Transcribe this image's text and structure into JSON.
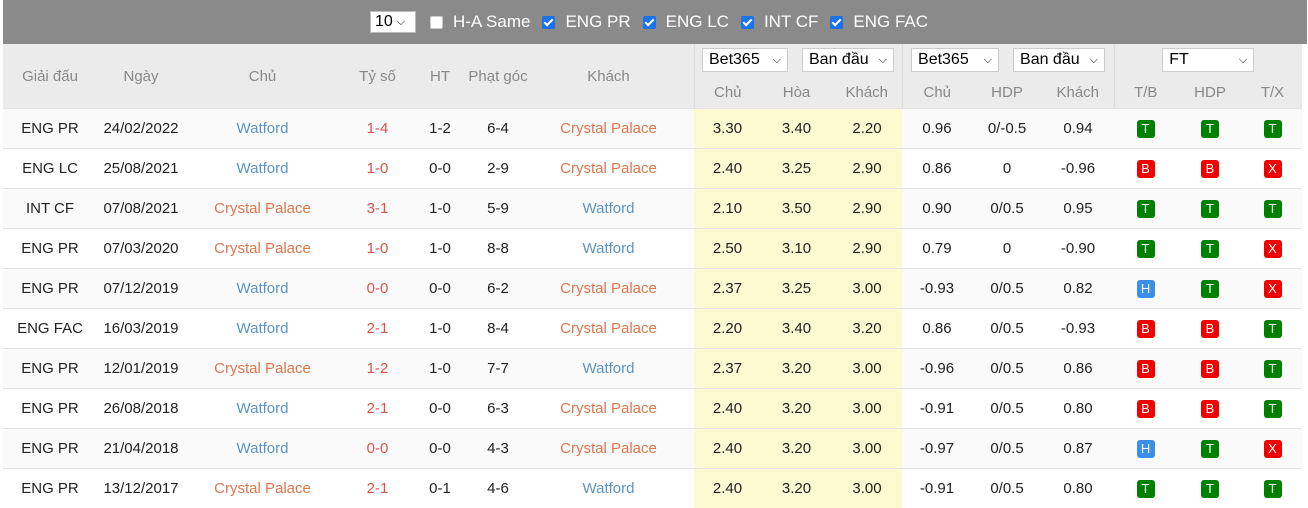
{
  "filter_bar": {
    "count_select": "10",
    "checkboxes": [
      {
        "label": "H-A Same",
        "checked": false
      },
      {
        "label": "ENG PR",
        "checked": true
      },
      {
        "label": "ENG LC",
        "checked": true
      },
      {
        "label": "INT CF",
        "checked": true
      },
      {
        "label": "ENG FAC",
        "checked": true
      }
    ]
  },
  "header": {
    "league": "Giải đấu",
    "date": "Ngày",
    "home": "Chủ",
    "score": "Tỷ số",
    "ht": "HT",
    "corners": "Phạt góc",
    "away": "Khách",
    "odds1_bookmaker": "Bet365",
    "odds1_type": "Ban đầu",
    "odds1_cols": [
      "Chủ",
      "Hòa",
      "Khách"
    ],
    "odds2_bookmaker": "Bet365",
    "odds2_type": "Ban đầu",
    "odds2_cols": [
      "Chủ",
      "HDP",
      "Khách"
    ],
    "result_select": "FT",
    "result_cols": [
      "T/B",
      "HDP",
      "T/X"
    ]
  },
  "colors": {
    "win": "#008000",
    "lose": "#f00000",
    "draw": "#3a8ee6",
    "crystal_palace": "#e0764e",
    "watford": "#5b94c7",
    "score": "#d9534f",
    "odds_highlight": "#fbfad0"
  },
  "rows": [
    {
      "league": "ENG PR",
      "date": "24/02/2022",
      "home": "Watford",
      "score": "1-4",
      "ht": "1-2",
      "corners": "6-4",
      "away": "Crystal Palace",
      "o_home": "3.30",
      "o_draw": "3.40",
      "o_away": "2.20",
      "h_home": "0.96",
      "h_line": "0/-0.5",
      "h_away": "0.94",
      "tb": "T",
      "hdp": "T",
      "tx": "T"
    },
    {
      "league": "ENG LC",
      "date": "25/08/2021",
      "home": "Watford",
      "score": "1-0",
      "ht": "0-0",
      "corners": "2-9",
      "away": "Crystal Palace",
      "o_home": "2.40",
      "o_draw": "3.25",
      "o_away": "2.90",
      "h_home": "0.86",
      "h_line": "0",
      "h_away": "-0.96",
      "tb": "B",
      "hdp": "B",
      "tx": "X"
    },
    {
      "league": "INT CF",
      "date": "07/08/2021",
      "home": "Crystal Palace",
      "score": "3-1",
      "ht": "1-0",
      "corners": "5-9",
      "away": "Watford",
      "o_home": "2.10",
      "o_draw": "3.50",
      "o_away": "2.90",
      "h_home": "0.90",
      "h_line": "0/0.5",
      "h_away": "0.95",
      "tb": "T",
      "hdp": "T",
      "tx": "T"
    },
    {
      "league": "ENG PR",
      "date": "07/03/2020",
      "home": "Crystal Palace",
      "score": "1-0",
      "ht": "1-0",
      "corners": "8-8",
      "away": "Watford",
      "o_home": "2.50",
      "o_draw": "3.10",
      "o_away": "2.90",
      "h_home": "0.79",
      "h_line": "0",
      "h_away": "-0.90",
      "tb": "T",
      "hdp": "T",
      "tx": "X"
    },
    {
      "league": "ENG PR",
      "date": "07/12/2019",
      "home": "Watford",
      "score": "0-0",
      "ht": "0-0",
      "corners": "6-2",
      "away": "Crystal Palace",
      "o_home": "2.37",
      "o_draw": "3.25",
      "o_away": "3.00",
      "h_home": "-0.93",
      "h_line": "0/0.5",
      "h_away": "0.82",
      "tb": "H",
      "hdp": "T",
      "tx": "X"
    },
    {
      "league": "ENG FAC",
      "date": "16/03/2019",
      "home": "Watford",
      "score": "2-1",
      "ht": "1-0",
      "corners": "8-4",
      "away": "Crystal Palace",
      "o_home": "2.20",
      "o_draw": "3.40",
      "o_away": "3.20",
      "h_home": "0.86",
      "h_line": "0/0.5",
      "h_away": "-0.93",
      "tb": "B",
      "hdp": "B",
      "tx": "T"
    },
    {
      "league": "ENG PR",
      "date": "12/01/2019",
      "home": "Crystal Palace",
      "score": "1-2",
      "ht": "1-0",
      "corners": "7-7",
      "away": "Watford",
      "o_home": "2.37",
      "o_draw": "3.20",
      "o_away": "3.00",
      "h_home": "-0.96",
      "h_line": "0/0.5",
      "h_away": "0.86",
      "tb": "B",
      "hdp": "B",
      "tx": "T"
    },
    {
      "league": "ENG PR",
      "date": "26/08/2018",
      "home": "Watford",
      "score": "2-1",
      "ht": "0-0",
      "corners": "6-3",
      "away": "Crystal Palace",
      "o_home": "2.40",
      "o_draw": "3.20",
      "o_away": "3.00",
      "h_home": "-0.91",
      "h_line": "0/0.5",
      "h_away": "0.80",
      "tb": "B",
      "hdp": "B",
      "tx": "T"
    },
    {
      "league": "ENG PR",
      "date": "21/04/2018",
      "home": "Watford",
      "score": "0-0",
      "ht": "0-0",
      "corners": "4-3",
      "away": "Crystal Palace",
      "o_home": "2.40",
      "o_draw": "3.20",
      "o_away": "3.00",
      "h_home": "-0.97",
      "h_line": "0/0.5",
      "h_away": "0.87",
      "tb": "H",
      "hdp": "T",
      "tx": "X"
    },
    {
      "league": "ENG PR",
      "date": "13/12/2017",
      "home": "Crystal Palace",
      "score": "2-1",
      "ht": "0-1",
      "corners": "4-6",
      "away": "Watford",
      "o_home": "2.40",
      "o_draw": "3.20",
      "o_away": "3.00",
      "h_home": "-0.91",
      "h_line": "0/0.5",
      "h_away": "0.80",
      "tb": "T",
      "hdp": "T",
      "tx": "T"
    }
  ]
}
